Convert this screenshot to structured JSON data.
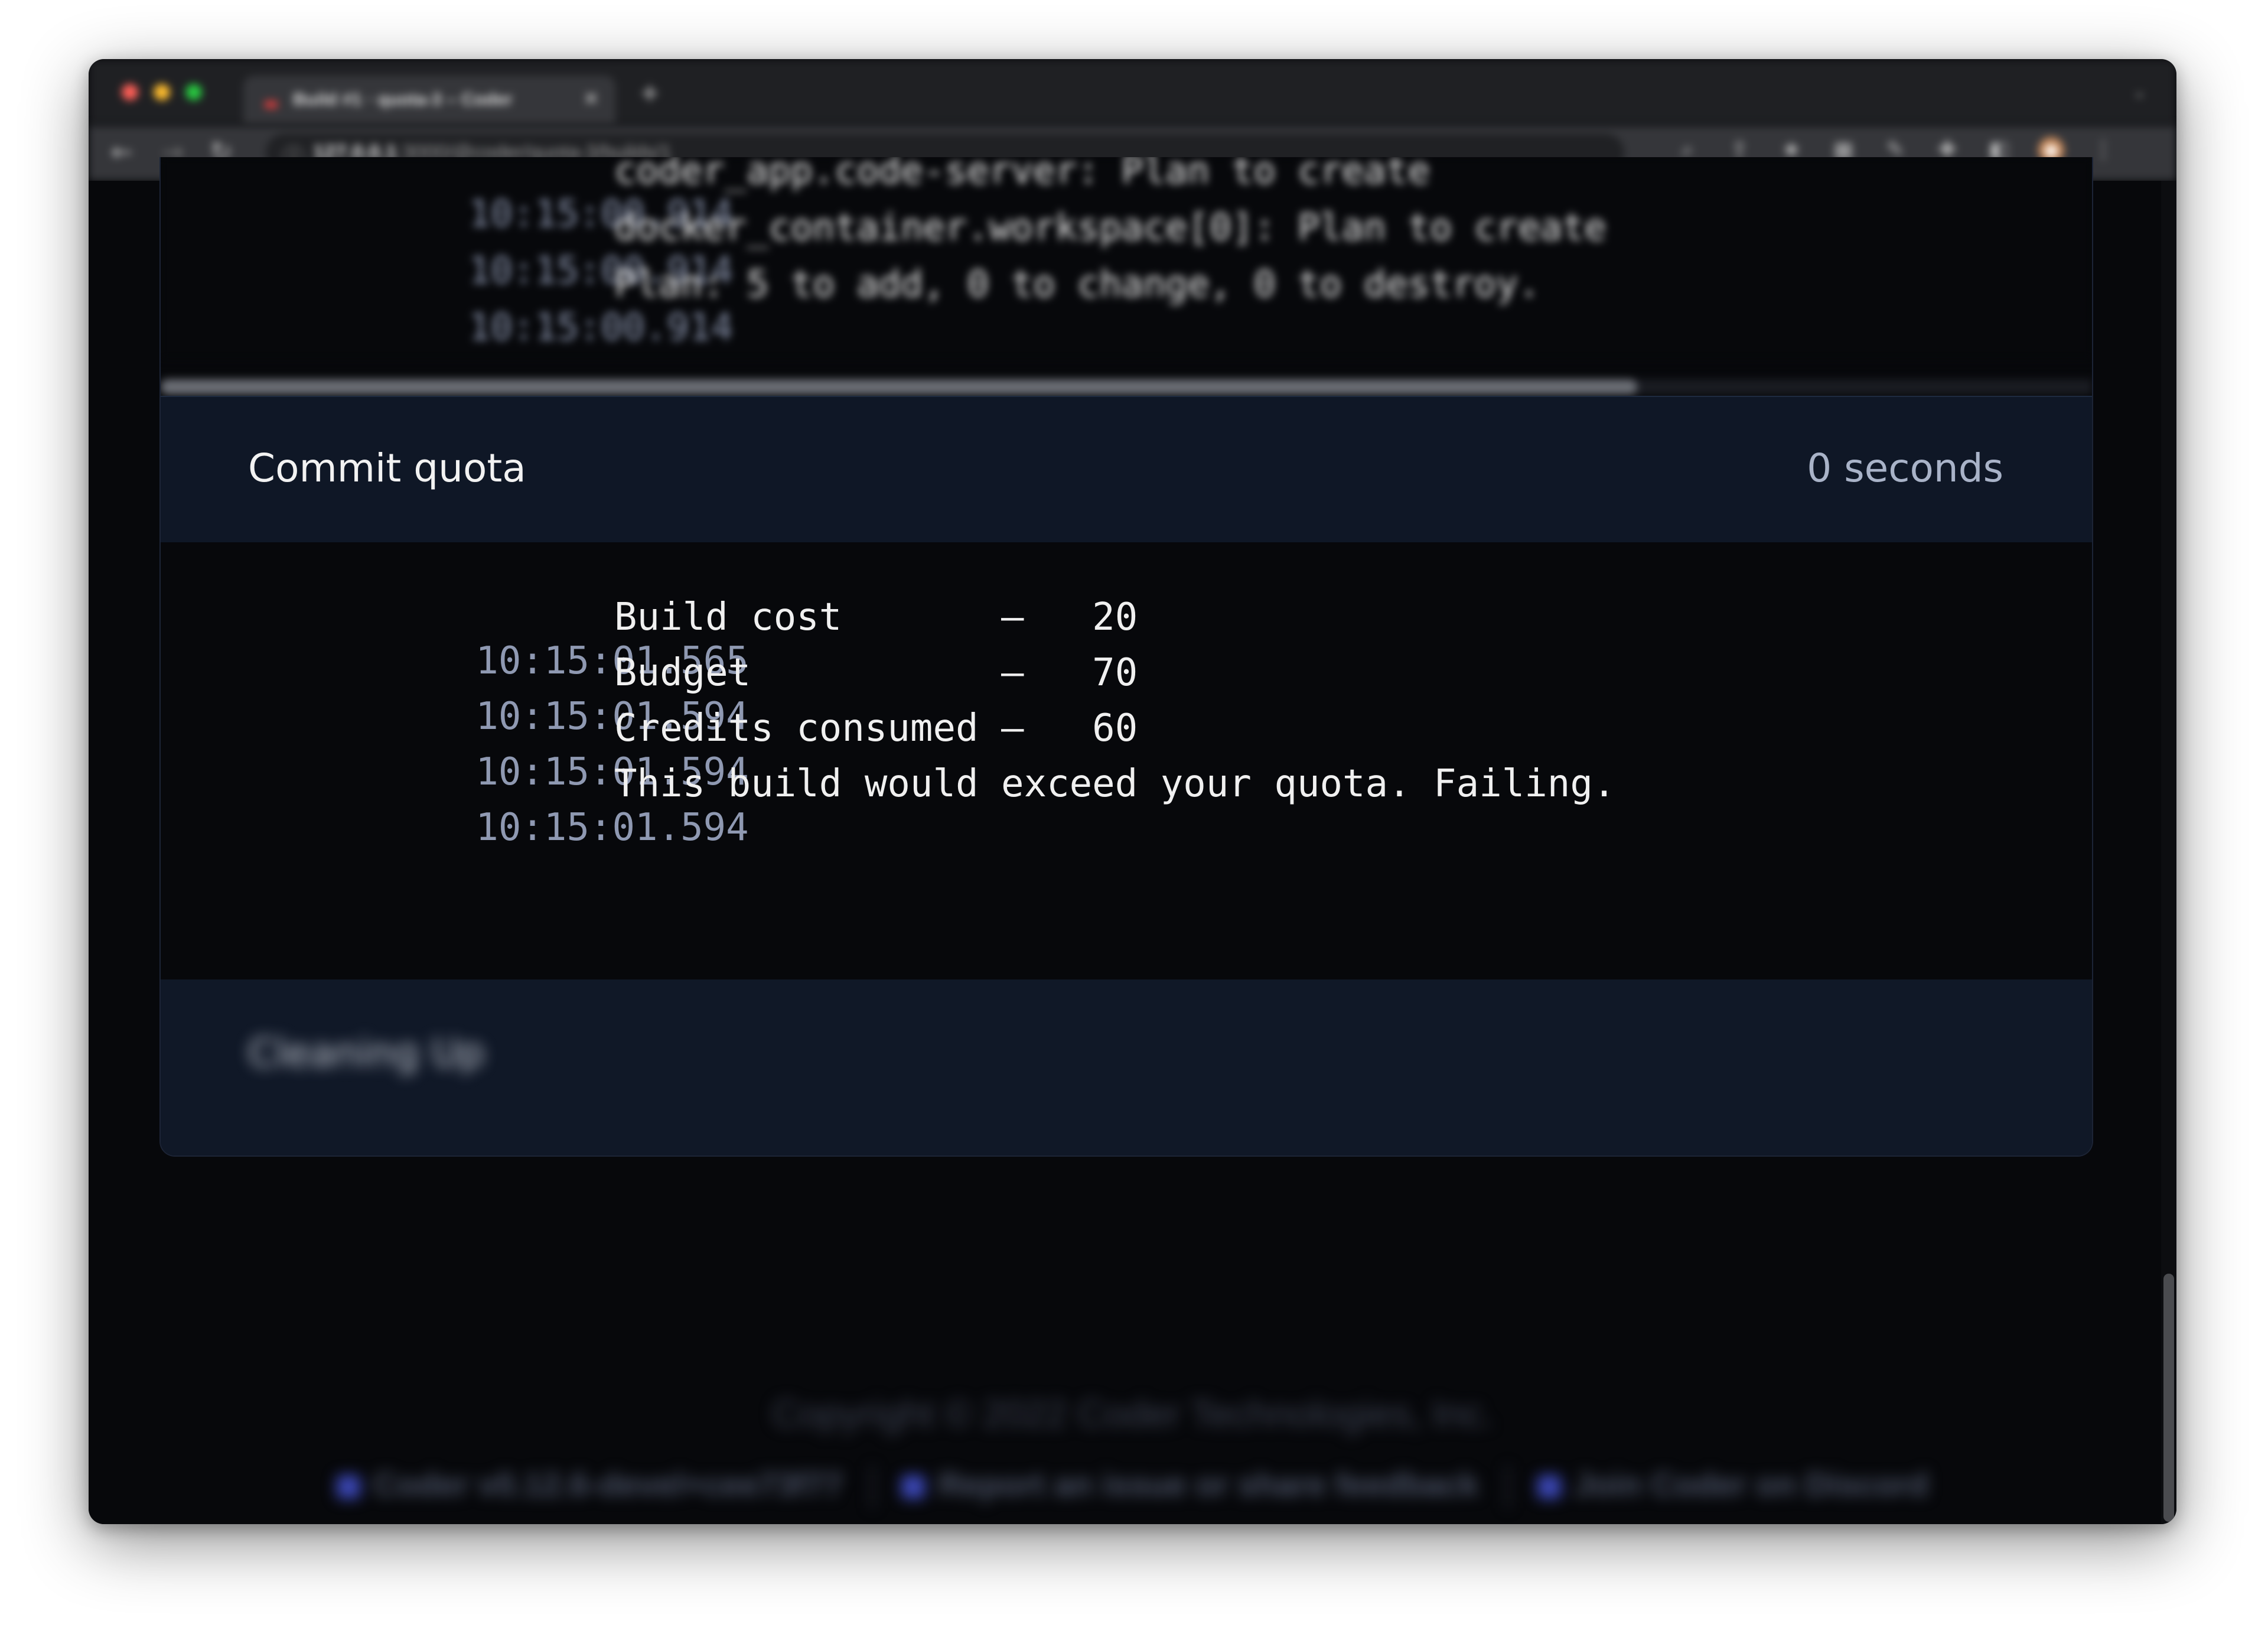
{
  "browser": {
    "tab_title": "Build #1 · quota-3 – Coder",
    "tab_close": "×",
    "new_tab": "+",
    "url_host": "127.0.0.1",
    "url_path": ":3000/@coder/quota-3/builds/1"
  },
  "log_top": {
    "lines": [
      {
        "time": "10:15:00.914",
        "text": "coder_app.code-server: Plan to create"
      },
      {
        "time": "10:15:00.914",
        "text": "docker_container.workspace[0]: Plan to create"
      },
      {
        "time": "10:15:00.914",
        "text": "Plan: 5 to add, 0 to change, 0 to destroy."
      }
    ]
  },
  "stage": {
    "title": "Commit quota",
    "duration": "0 seconds"
  },
  "quota_log": {
    "lines": [
      {
        "time": "10:15:01.565",
        "text": "Build cost       —   20"
      },
      {
        "time": "10:15:01.594",
        "text": "Budget           —   70"
      },
      {
        "time": "10:15:01.594",
        "text": "Credits consumed —   60"
      },
      {
        "time": "10:15:01.594",
        "text": "This build would exceed your quota. Failing."
      }
    ]
  },
  "next_stage": {
    "title": "Cleaning Up"
  },
  "footer": {
    "copyright": "Copyright © 2022 Coder Technologies, Inc.",
    "version": "Coder v0.12.6-devel+cee73f77",
    "report": "Report an issue or share feedback",
    "discord": "Join Coder on Discord"
  },
  "colors": {
    "page_bg": "#07080b",
    "stage_header_bg": "#0f1726",
    "timestamp": "#8f99b2",
    "accent": "#3c48b8"
  }
}
